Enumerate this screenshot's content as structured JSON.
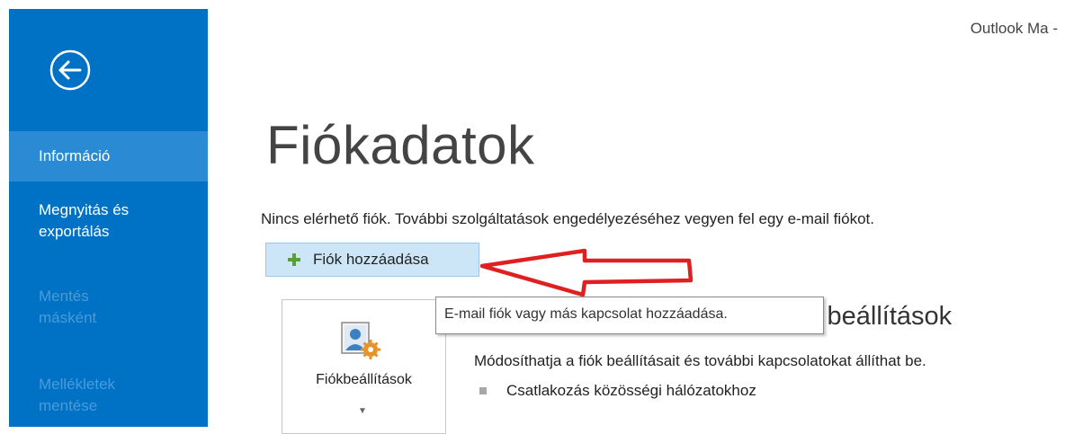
{
  "window": {
    "title": "Outlook Ma -"
  },
  "sidebar": {
    "back_icon": "back-arrow-icon",
    "items": [
      {
        "label_lines": [
          "Információ"
        ],
        "state": "selected"
      },
      {
        "label_lines": [
          "Megnyitás és",
          "exportálás"
        ],
        "state": "enabled"
      },
      {
        "label_lines": [
          "Mentés",
          "másként"
        ],
        "state": "disabled"
      },
      {
        "label_lines": [
          "Mellékletek",
          "mentése"
        ],
        "state": "disabled"
      }
    ],
    "colors": {
      "background": "#0072c6",
      "selected": "#2a8ad4",
      "disabled_text": "#4a9bd8"
    }
  },
  "main": {
    "page_title": "Fiókadatok",
    "info_text": "Nincs elérhető fiók. További szolgáltatások engedélyezéséhez vegyen fel egy e-mail fiókot.",
    "add_account_button": {
      "label": "Fiók hozzáadása",
      "icon": "plus-icon"
    },
    "tooltip": "E-mail fiók vagy más kapcsolat hozzáadása.",
    "account_settings": {
      "button_label": "Fiókbeállítások",
      "icon": "account-settings-icon",
      "section_title": "i beállítások",
      "description": "Módosíthatja a fiók beállításait és további kapcsolatokat állíthat be.",
      "bullets": [
        "Csatlakozás közösségi hálózatokhoz"
      ]
    },
    "annotation": {
      "type": "arrow",
      "color": "#e02020"
    }
  }
}
